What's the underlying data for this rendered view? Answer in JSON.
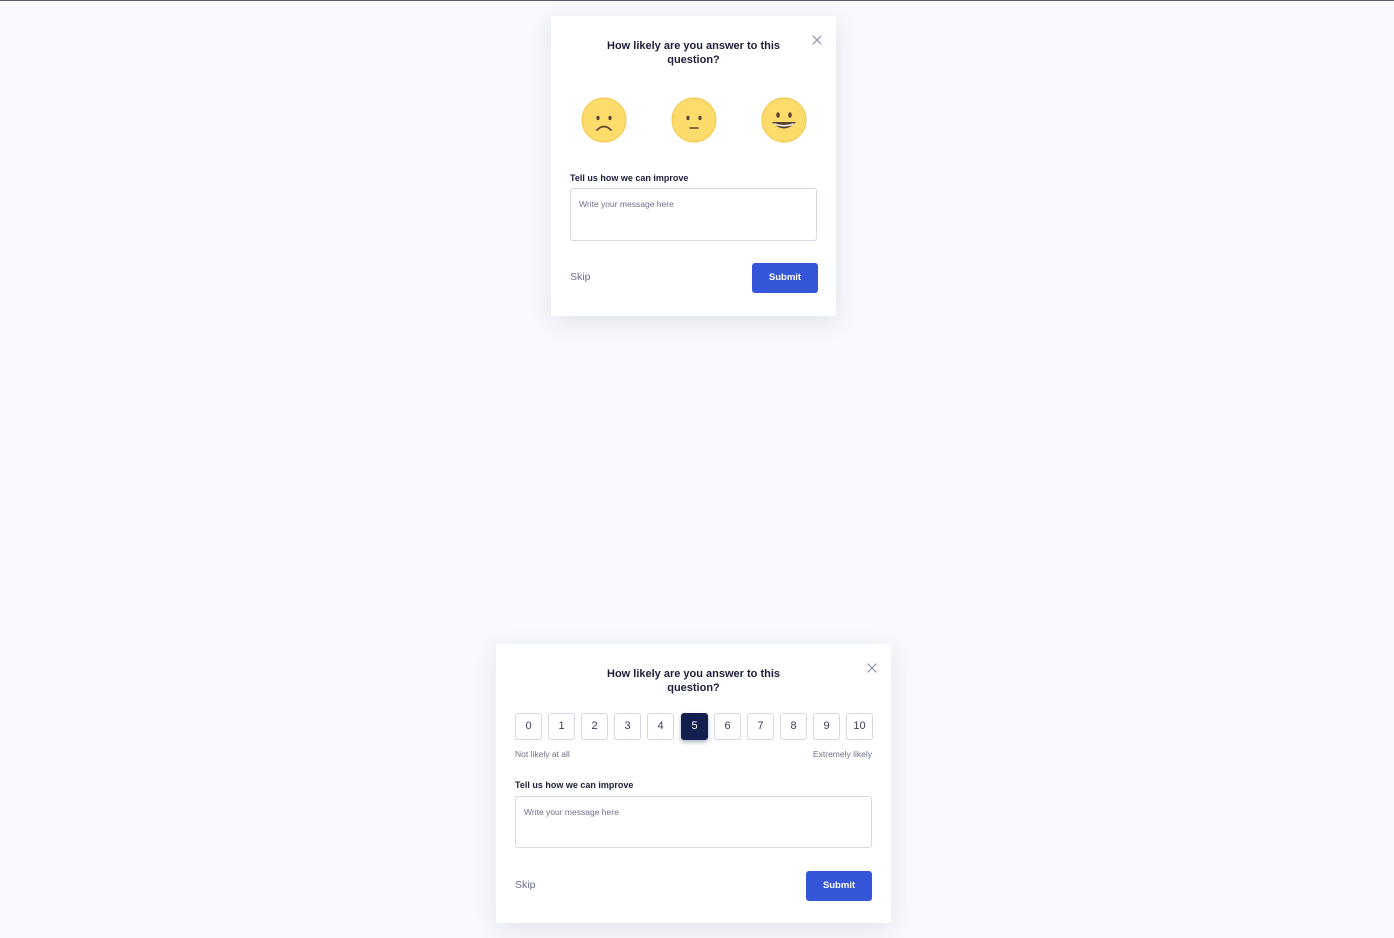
{
  "colors": {
    "page_background": "#f7f9fc",
    "card_background": "#ffffff",
    "accent": "#3556d8",
    "selected_scale": "#13204f",
    "emoji_face": "#fddc6b",
    "text_primary": "#1c1f3a",
    "text_muted": "#6b7089"
  },
  "emoji_survey": {
    "title": "How likely are you answer to this\nquestion?",
    "close_icon": "close-icon",
    "emojis": [
      {
        "name": "sad-face-icon",
        "mood": "sad"
      },
      {
        "name": "neutral-face-icon",
        "mood": "neutral"
      },
      {
        "name": "happy-face-icon",
        "mood": "happy"
      }
    ],
    "feedback_label": "Tell us how we can improve",
    "feedback_placeholder": "Write your message here",
    "skip_label": "Skip",
    "submit_label": "Submit"
  },
  "nps_survey": {
    "title": "How likely are you answer to this\nquestion?",
    "close_icon": "close-icon",
    "scale": [
      "0",
      "1",
      "2",
      "3",
      "4",
      "5",
      "6",
      "7",
      "8",
      "9",
      "10"
    ],
    "selected_value": "5",
    "min_label": "Not likely at all",
    "max_label": "Extremely likely",
    "feedback_label": "Tell us how we can improve",
    "feedback_placeholder": "Write your message here",
    "skip_label": "Skip",
    "submit_label": "Submit"
  }
}
